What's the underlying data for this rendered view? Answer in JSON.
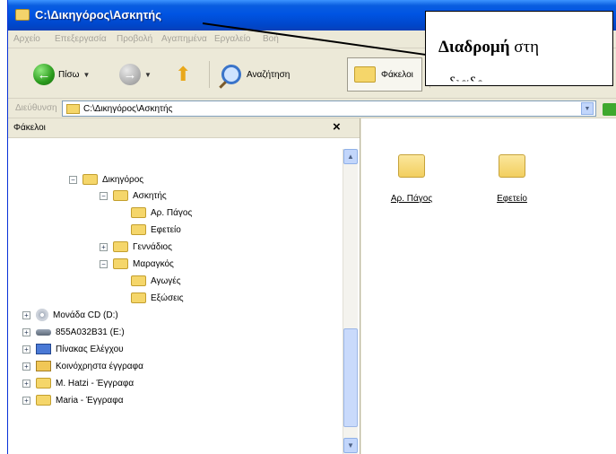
{
  "window": {
    "title": "C:\\Δικηγόρος\\Ασκητής"
  },
  "menu": {
    "items": [
      "Αρχείο",
      "Επεξεργασία",
      "Προβολή",
      "Αγαπημένα",
      "Εργαλείο",
      "Βοή"
    ]
  },
  "toolbar": {
    "back_label": "Πίσω",
    "search_label": "Αναζήτηση",
    "folders_label": "Φάκελοι"
  },
  "address": {
    "label": "Διεύθυνση",
    "value": "C:\\Δικηγόρος\\Ασκητής"
  },
  "folders_pane": {
    "title": "Φάκελοι",
    "close_symbol": "×",
    "tree": [
      {
        "label": "Δικηγόρος",
        "expander": "−"
      },
      {
        "label": "Ασκητής",
        "expander": "−"
      },
      {
        "label": "Αρ. Πάγος",
        "expander": ""
      },
      {
        "label": "Εφετείο",
        "expander": ""
      },
      {
        "label": "Γεννάδιος",
        "expander": "+"
      },
      {
        "label": "Μαραγκός",
        "expander": "−"
      },
      {
        "label": "Αγωγές",
        "expander": ""
      },
      {
        "label": "Εξώσεις",
        "expander": ""
      },
      {
        "label": "Μονάδα CD (D:)",
        "expander": "+"
      },
      {
        "label": "855A032B31 (E:)",
        "expander": "+"
      },
      {
        "label": "Πίνακας Ελέγχου",
        "expander": "+"
      },
      {
        "label": "Κοινόχρηστα έγγραφα",
        "expander": "+"
      },
      {
        "label": "M. Hatzi - Έγγραφα",
        "expander": "+"
      },
      {
        "label": "Maria - Έγγραφα",
        "expander": "+"
      }
    ]
  },
  "content": {
    "folders": [
      "Αρ. Πάγος",
      "Εφετείο"
    ]
  },
  "callout": {
    "bold": "Διαδρομή",
    "rest": " στη",
    "cut": "διαδρ"
  }
}
